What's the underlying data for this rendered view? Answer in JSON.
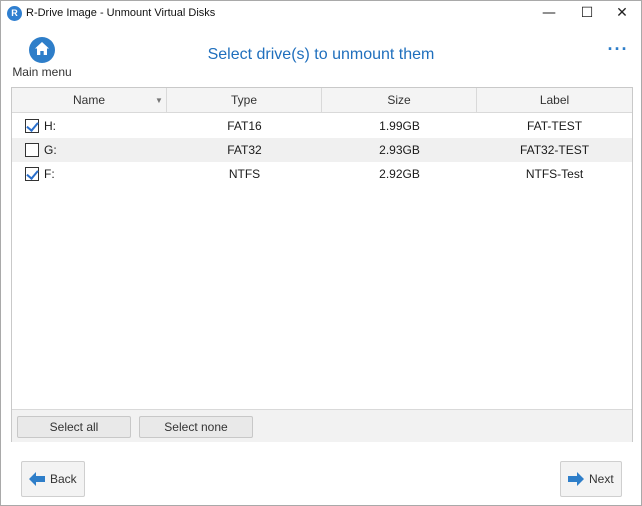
{
  "window": {
    "title": "R-Drive Image - Unmount Virtual Disks",
    "app_icon_letter": "R",
    "minimize_glyph": "—",
    "maximize_glyph": "☐",
    "close_glyph": "✕"
  },
  "header": {
    "home_label": "Main menu",
    "home_icon": "home-icon",
    "title": "Select drive(s) to unmount them",
    "more_glyph": "···",
    "accent_color": "#1f6fbd"
  },
  "grid": {
    "columns": [
      "Name",
      "Type",
      "Size",
      "Label"
    ],
    "sort_indicator": "▼",
    "rows": [
      {
        "checked": true,
        "name": "H:",
        "type": "FAT16",
        "size": "1.99GB",
        "label": "FAT-TEST"
      },
      {
        "checked": false,
        "name": "G:",
        "type": "FAT32",
        "size": "2.93GB",
        "label": "FAT32-TEST"
      },
      {
        "checked": true,
        "name": "F:",
        "type": "NTFS",
        "size": "2.92GB",
        "label": "NTFS-Test"
      }
    ]
  },
  "panel_buttons": {
    "select_all": "Select all",
    "select_none": "Select none"
  },
  "nav": {
    "back": "Back",
    "next": "Next",
    "arrow_color": "#2e7ec9"
  }
}
